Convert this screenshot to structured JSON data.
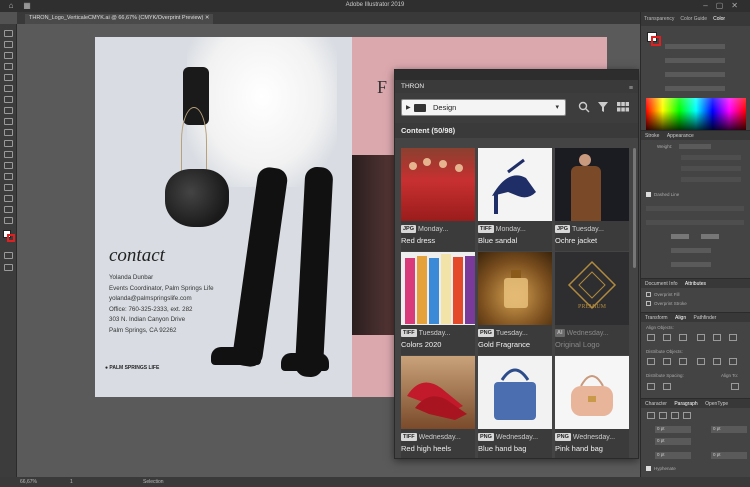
{
  "app": {
    "title": "Adobe Illustrator 2019",
    "doc_tab": "THRON_Logo_VerticaleCMYK.ai @ 66,67% (CMYK/Overprint Preview)"
  },
  "artboard": {
    "contact_heading": "contact",
    "contact_lines": [
      "Yolanda Dunbar",
      "Events Coordinator, Palm Springs Life",
      "yolanda@palmspringslife.com",
      "Office: 760-325-2333, ext. 282",
      "303 N. Indian Canyon Drive",
      "Palm Springs, CA 92262"
    ],
    "brand_footer": "● PALM SPRINGS LIFE",
    "right_letter": "F"
  },
  "thron_panel": {
    "header_label": "",
    "tab_label": "THRON",
    "menu_icon": "hamburger-icon",
    "folder_name": "Design",
    "content_heading": "Content (50/98)",
    "tools": [
      "search-icon",
      "filter-icon",
      "grid-view-icon"
    ],
    "items": [
      {
        "type": "JPG",
        "day": "Monday...",
        "name": "Red dress",
        "thumb": "red-dress"
      },
      {
        "type": "TIFF",
        "day": "Monday...",
        "name": "Blue sandal",
        "thumb": "blue-sandal"
      },
      {
        "type": "JPG",
        "day": "Tuesday...",
        "name": "Ochre jacket",
        "thumb": "ochre-jacket"
      },
      {
        "type": "TIFF",
        "day": "Tuesday...",
        "name": "Colors 2020",
        "thumb": "colors-2020"
      },
      {
        "type": "PNG",
        "day": "Tuesday...",
        "name": "Gold Fragrance",
        "thumb": "gold-fragrance"
      },
      {
        "type": "AI",
        "day": "Wednesday...",
        "name": "Original Logo",
        "thumb": "original-logo",
        "dim": true
      },
      {
        "type": "TIFF",
        "day": "Wednesday...",
        "name": "Red high heels",
        "thumb": "red-heels"
      },
      {
        "type": "PNG",
        "day": "Wednesday...",
        "name": "Blue hand bag",
        "thumb": "blue-bag"
      },
      {
        "type": "PNG",
        "day": "Wednesday...",
        "name": "Pink hand bag",
        "thumb": "pink-bag"
      }
    ],
    "logo_text": "PREMIUM"
  },
  "right_panel": {
    "tabs": [
      "Transparency",
      "Color Guide",
      "Color"
    ],
    "stroke_tabs": [
      "Stroke",
      "Appearance"
    ],
    "weight_label": "Weight:",
    "dashed_label": "Dashed Line",
    "doc_info_tabs": [
      "Document Info",
      "Attributes"
    ],
    "overprint_fill": "Overprint Fill",
    "overprint_stroke": "Overprint Stroke",
    "align_tabs": [
      "Transform",
      "Align",
      "Pathfinder"
    ],
    "align_objects": "Align Objects:",
    "distribute_objects": "Distribute Objects:",
    "distribute_spacing": "Distribute Spacing:",
    "align_to": "Align To:",
    "para_tabs": [
      "Character",
      "Paragraph",
      "OpenType"
    ],
    "pt_values": [
      "0 pt",
      "0 pt",
      "0 pt",
      "0 pt",
      "0 pt"
    ],
    "hyphenate": "Hyphenate"
  },
  "status": {
    "zoom": "66,67%",
    "page": "1",
    "selection": "Selection"
  }
}
